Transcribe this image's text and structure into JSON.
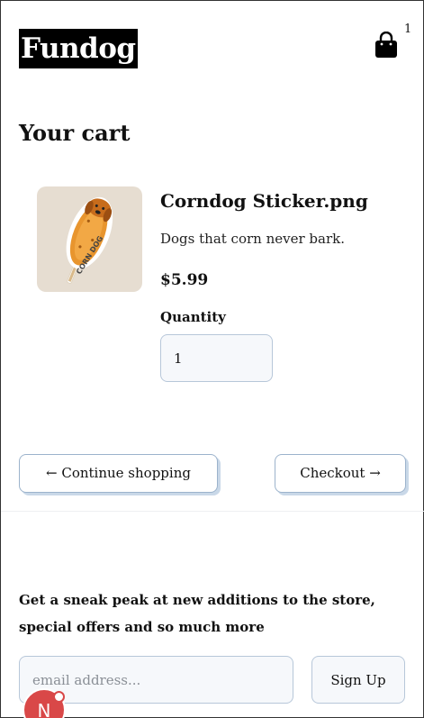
{
  "header": {
    "logo": "Fundog",
    "cart_count": "1",
    "cart_icon": "shopping-bag-icon"
  },
  "cart": {
    "title": "Your cart",
    "items": [
      {
        "name": "Corndog Sticker.png",
        "description": "Dogs that corn never bark.",
        "price": "$5.99",
        "quantity_label": "Quantity",
        "quantity": "1",
        "image_icon": "corndog-sticker-image",
        "image_text": "CORN DOG"
      }
    ],
    "continue_label": "← Continue shopping",
    "checkout_label": "Checkout →"
  },
  "newsletter": {
    "text": "Get a sneak peak at new additions to the store, special offers and so much more",
    "email_placeholder": "email address...",
    "signup_label": "Sign Up"
  },
  "avatar": {
    "initial": "N"
  },
  "colors": {
    "accent_border": "#9cb3cc",
    "input_bg": "#f6f8fb",
    "image_bg": "#e6ddd1",
    "avatar_bg": "#d94848"
  }
}
